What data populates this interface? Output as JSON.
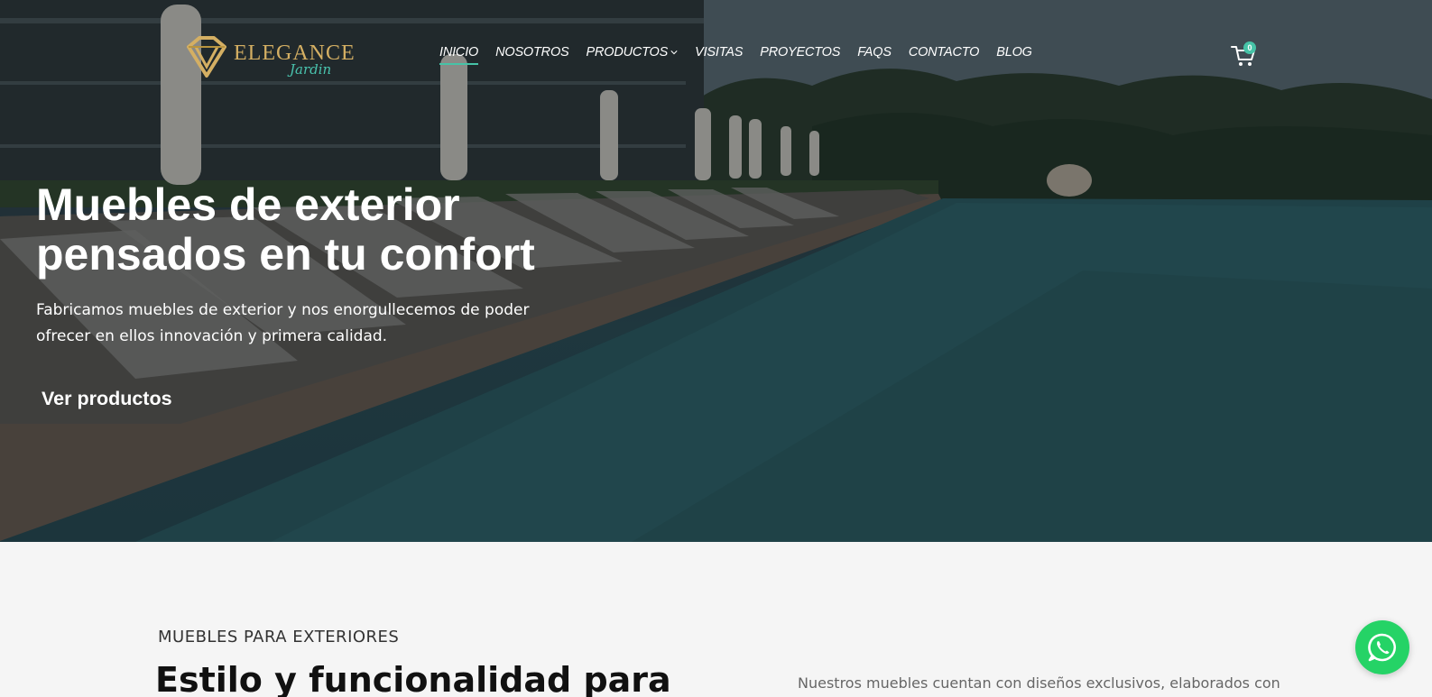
{
  "brand": {
    "name": "ELEGANCE",
    "tagline": "Jardin",
    "gold": "#d4af63",
    "accent": "#46c3a7"
  },
  "nav": {
    "items": [
      {
        "label": "INICIO",
        "active": true
      },
      {
        "label": "NOSOTROS"
      },
      {
        "label": "PRODUCTOS",
        "has_dropdown": true
      },
      {
        "label": "VISITAS"
      },
      {
        "label": "PROYECTOS"
      },
      {
        "label": "FAQS"
      },
      {
        "label": "CONTACTO"
      },
      {
        "label": "BLOG"
      }
    ]
  },
  "cart": {
    "count": "0",
    "icon": "cart-icon"
  },
  "hero": {
    "title": "Muebles de exterior pensados en tu confort",
    "subtitle": "Fabricamos muebles de exterior y nos enorgullecemos de poder ofrecer en ellos innovación y primera calidad.",
    "cta": "Ver productos"
  },
  "section": {
    "eyebrow": "MUEBLES PARA EXTERIORES",
    "title": "Estilo y funcionalidad para",
    "description": "Nuestros muebles cuentan con diseños exclusivos, elaborados con"
  },
  "whatsapp": {
    "icon": "whatsapp-icon",
    "color": "#25d366"
  }
}
